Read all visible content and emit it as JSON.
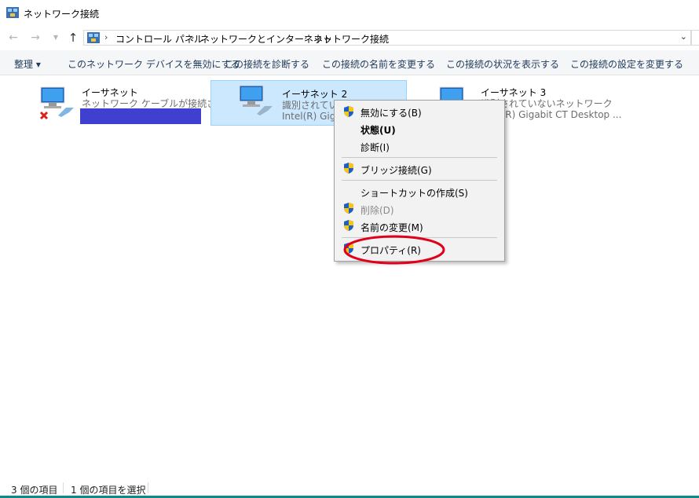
{
  "window": {
    "title": "ネットワーク接続"
  },
  "address": {
    "crumbs": [
      "コントロール パネル",
      "ネットワークとインターネット",
      "ネットワーク接続"
    ]
  },
  "toolbar": {
    "organize": "整理 ▾",
    "disable": "このネットワーク デバイスを無効にする",
    "diagnose": "この接続を診断する",
    "rename": "この接続の名前を変更する",
    "status": "この接続の状況を表示する",
    "settings": "この接続の設定を変更する"
  },
  "connections": [
    {
      "name": "イーサネット",
      "line1": "ネットワーク ケーブルが接続され...",
      "line2": "",
      "disconnected": true
    },
    {
      "name": "イーサネット 2",
      "line1": "識別されていないネットワーク",
      "line2": "Intel(R) Gigabit CT Desktop ...",
      "selected": true
    },
    {
      "name": "イーサネット 3",
      "line1": "識別されていないネットワーク",
      "line2": "Intel(R) Gigabit CT Desktop ..."
    }
  ],
  "context_menu": {
    "items": [
      {
        "label": "無効にする(B)",
        "shield": true
      },
      {
        "label": "状態(U)",
        "bold": true
      },
      {
        "label": "診断(I)"
      },
      {
        "label": "ブリッジ接続(G)",
        "shield": true
      },
      {
        "label": "ショートカットの作成(S)"
      },
      {
        "label": "削除(D)",
        "shield": true,
        "disabled": true
      },
      {
        "label": "名前の変更(M)",
        "shield": true
      },
      {
        "label": "プロパティ(R)",
        "shield": true
      }
    ]
  },
  "status": {
    "count": "3 個の項目",
    "selected": "1 個の項目を選択"
  },
  "colors": {
    "selection_bg": "#cce8ff",
    "redaction": "#4040d0",
    "annotation": "#e0001b"
  },
  "icons": {
    "back": "back-arrow-icon",
    "forward": "forward-arrow-icon",
    "up": "up-arrow-icon",
    "shield": "uac-shield-icon"
  }
}
